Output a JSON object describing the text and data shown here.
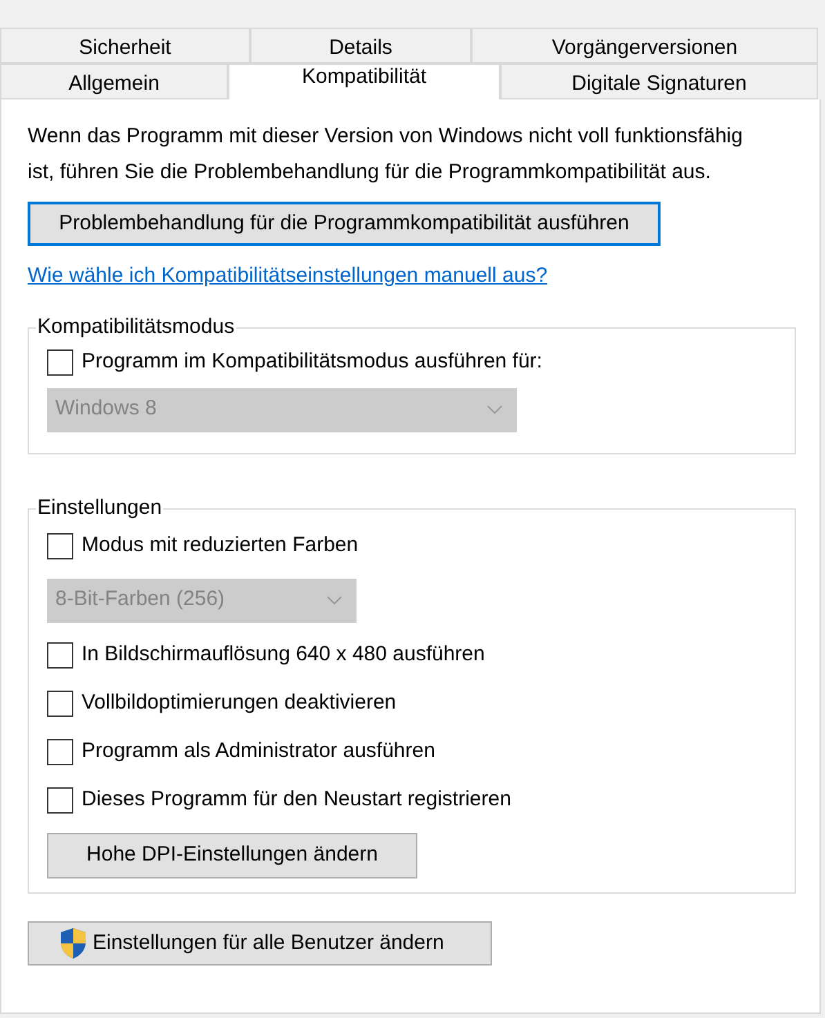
{
  "tab_rows": [
    [
      {
        "label": "Sicherheit",
        "selected": false
      },
      {
        "label": "Details",
        "selected": false
      },
      {
        "label": "Vorgängerversionen",
        "selected": false
      }
    ],
    [
      {
        "label": "Allgemein",
        "selected": false
      },
      {
        "label": "Kompatibilität",
        "selected": true
      },
      {
        "label": "Digitale Signaturen",
        "selected": false
      }
    ]
  ],
  "intro": "Wenn das Programm mit dieser Version von Windows nicht voll funktionsfähig ist, führen Sie die Problembehandlung für die Programmkompatibilität aus.",
  "troubleshoot_button": "Problembehandlung für die Programmkompatibilität ausführen",
  "help_link": "Wie wähle ich Kompatibilitätseinstellungen manuell aus?",
  "compat_group": {
    "title": "Kompatibilitätsmodus",
    "checkbox": {
      "label": "Programm im Kompatibilitätsmodus ausführen für:",
      "checked": false
    },
    "dropdown": {
      "value": "Windows 8",
      "disabled": true
    }
  },
  "settings_group": {
    "title": "Einstellungen",
    "items": [
      {
        "kind": "checkbox",
        "label": "Modus mit reduzierten Farben",
        "checked": false
      },
      {
        "kind": "dropdown",
        "value": "8-Bit-Farben (256)",
        "disabled": true
      },
      {
        "kind": "checkbox",
        "label": "In Bildschirmauflösung 640 x 480 ausführen",
        "checked": false
      },
      {
        "kind": "checkbox",
        "label": "Vollbildoptimierungen deaktivieren",
        "checked": false
      },
      {
        "kind": "checkbox",
        "label": "Programm als Administrator ausführen",
        "checked": false
      },
      {
        "kind": "checkbox",
        "label": "Dieses Programm für den Neustart registrieren",
        "checked": false
      },
      {
        "kind": "button",
        "label": "Hohe DPI-Einstellungen ändern"
      }
    ]
  },
  "all_users_button": "Einstellungen für alle Benutzer ändern"
}
